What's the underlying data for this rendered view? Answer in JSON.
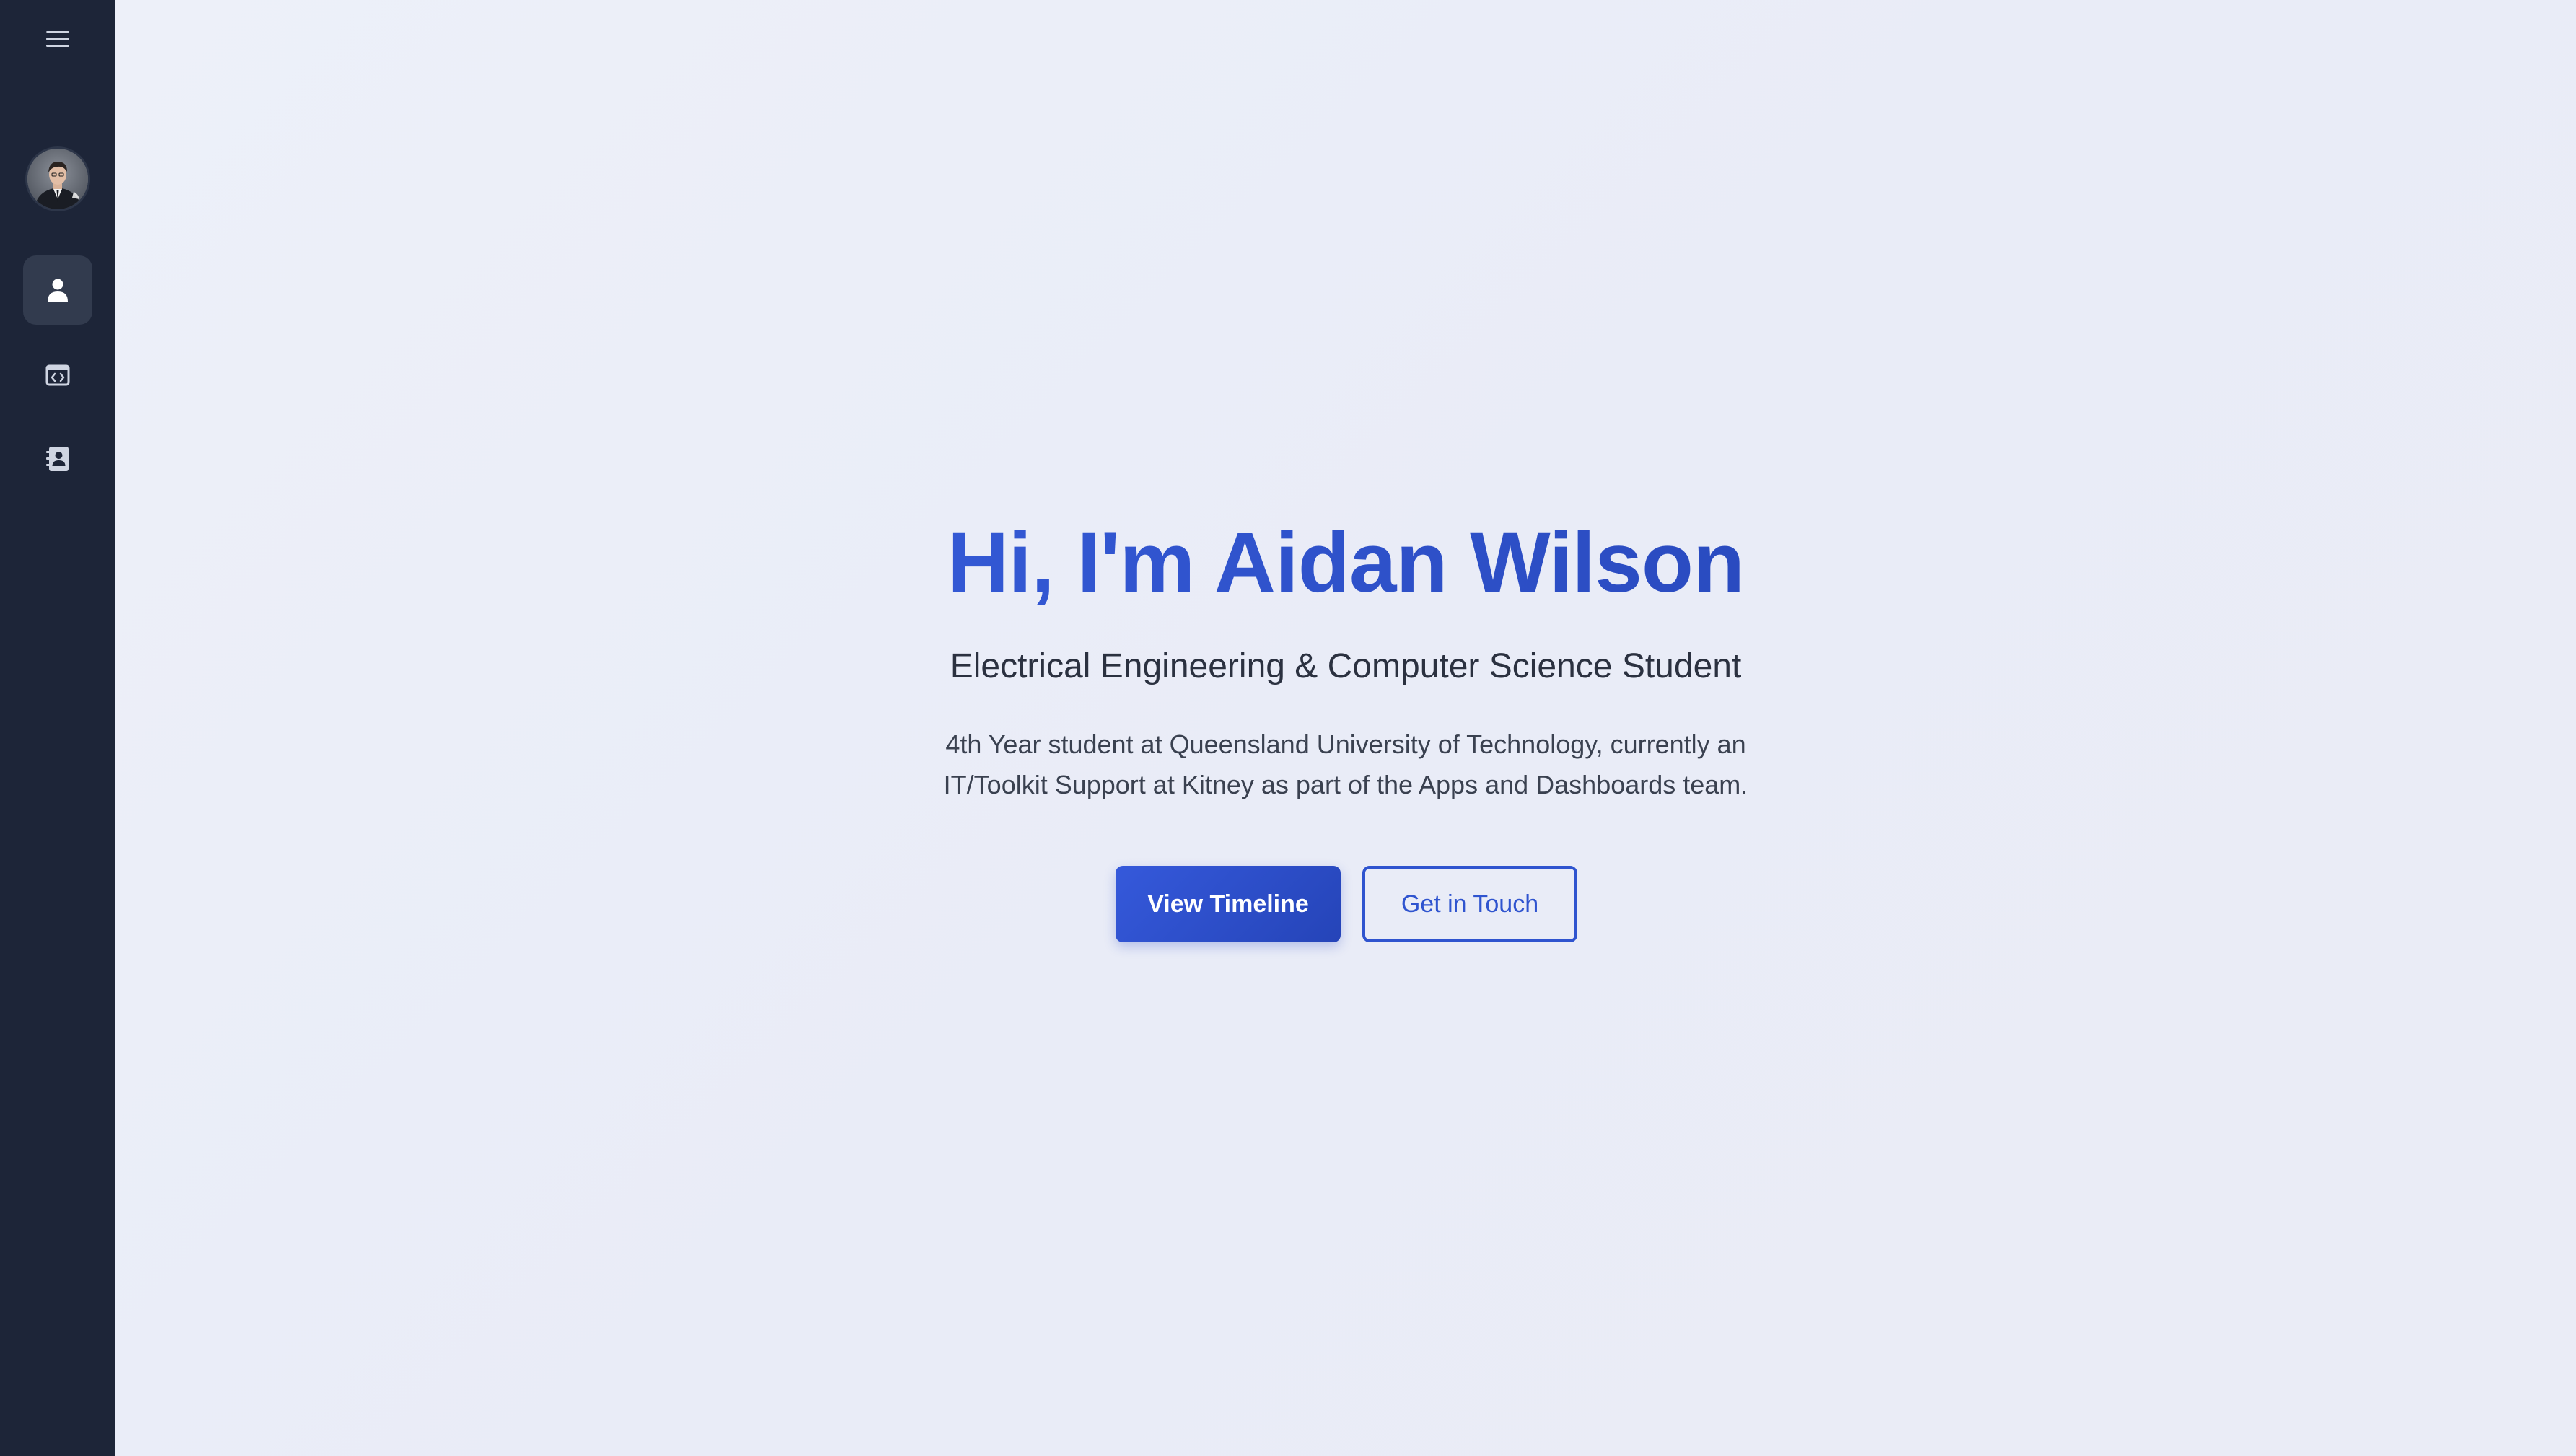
{
  "sidebar": {
    "menu_icon": "hamburger-menu-icon",
    "avatar_icon": "profile-photo",
    "nav_items": [
      {
        "key": "about",
        "icon": "user-icon",
        "active": true
      },
      {
        "key": "projects",
        "icon": "code-window-icon",
        "active": false
      },
      {
        "key": "contact",
        "icon": "contact-book-icon",
        "active": false
      }
    ],
    "colors": {
      "background": "#1d2538",
      "active_item": "#323b4e",
      "icon": "#cfd5e2"
    }
  },
  "hero": {
    "title": "Hi, I'm Aidan Wilson",
    "subtitle": "Electrical Engineering & Computer Science Student",
    "description_line1": "4th Year student at Queensland University of Technology, currently an",
    "description_line2": "IT/Toolkit Support at Kitney as part of the Apps and Dashboards team.",
    "primary_button": "View Timeline",
    "secondary_button": "Get in Touch"
  },
  "colors": {
    "accent": "#2f54cf",
    "page_background": "#e9ecf6",
    "text_dark": "#2b3140"
  }
}
